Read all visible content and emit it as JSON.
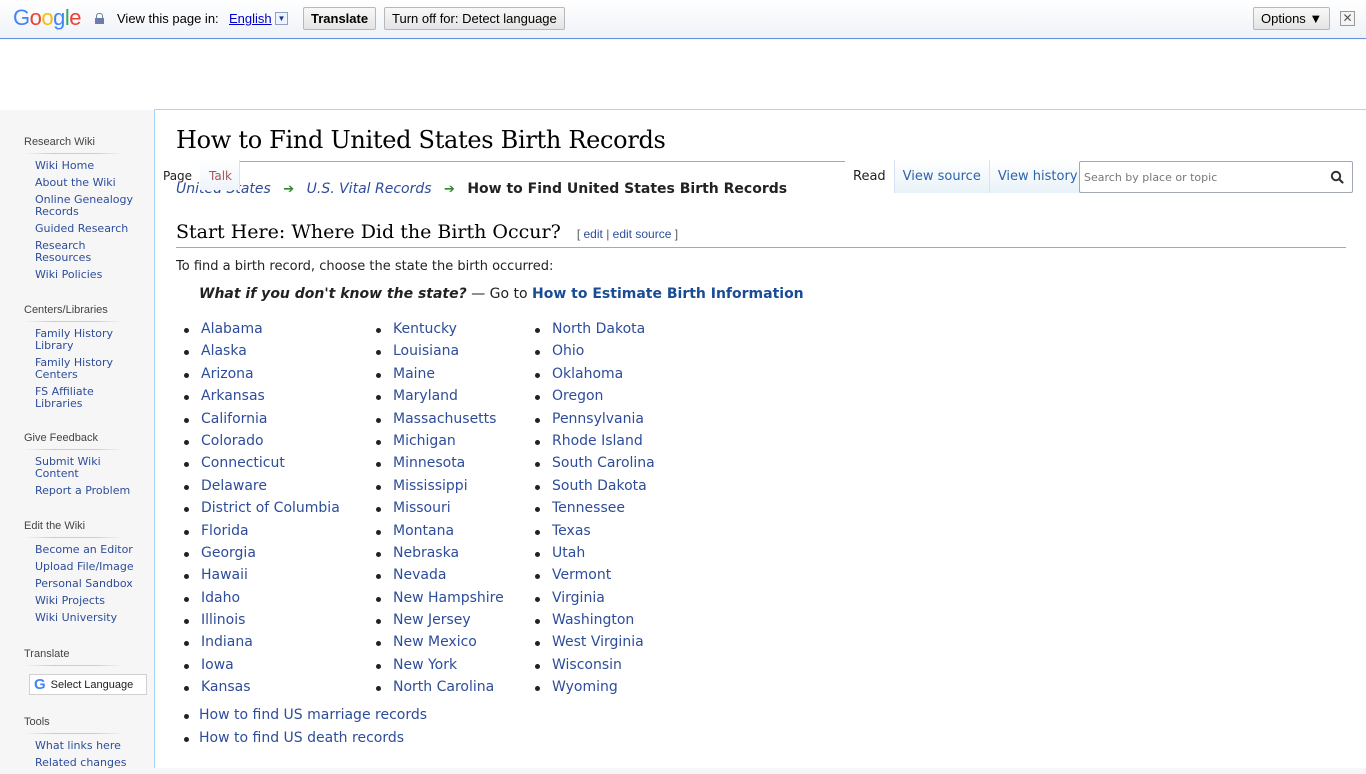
{
  "translate_bar": {
    "logo": [
      "G",
      "o",
      "o",
      "g",
      "l",
      "e"
    ],
    "view_in_label": "View this page in:",
    "language": "English",
    "translate_button": "Translate",
    "turn_off_button": "Turn off for: Detect language",
    "options_button": "Options ▼",
    "close": "✕"
  },
  "sidebar": {
    "sections": [
      {
        "title": "Research Wiki",
        "items": [
          "Wiki Home",
          "About the Wiki",
          "Online Genealogy Records",
          "Guided Research",
          "Research Resources",
          "Wiki Policies"
        ]
      },
      {
        "title": "Centers/Libraries",
        "items": [
          "Family History Library",
          "Family History Centers",
          "FS Affiliate Libraries"
        ]
      },
      {
        "title": "Give Feedback",
        "items": [
          "Submit Wiki Content",
          "Report a Problem"
        ]
      },
      {
        "title": "Edit the Wiki",
        "items": [
          "Become an Editor",
          "Upload File/Image",
          "Personal Sandbox",
          "Wiki Projects",
          "Wiki University"
        ]
      },
      {
        "title": "Translate",
        "select_language": "Select Language"
      },
      {
        "title": "Tools",
        "items": [
          "What links here",
          "Related changes"
        ]
      }
    ]
  },
  "page": {
    "title": "How to Find United States Birth Records",
    "tabs": {
      "page": "Page",
      "talk": "Talk",
      "read": "Read",
      "view_source": "View source",
      "view_history": "View history"
    },
    "search_placeholder": "Search by place or topic",
    "breadcrumb": {
      "first": "United States",
      "second": "U.S. Vital Records",
      "current": "How to Find United States Birth Records"
    },
    "section": {
      "heading": "Start Here: Where Did the Birth Occur?",
      "edit_open": "[",
      "edit": "edit",
      "edit_sep": "|",
      "edit_source": "edit source",
      "edit_close": "]"
    },
    "intro": "To find a birth record, choose the state the birth occurred:",
    "unknown_state": {
      "question": "What if you don't know the state?",
      "dash_text": " — Go to ",
      "link": "How to Estimate Birth Information"
    },
    "states_col1": [
      "Alabama",
      "Alaska",
      "Arizona",
      "Arkansas",
      "California",
      "Colorado",
      "Connecticut",
      "Delaware",
      "District of Columbia",
      "Florida",
      "Georgia",
      "Hawaii",
      "Idaho",
      "Illinois",
      "Indiana",
      "Iowa",
      "Kansas"
    ],
    "states_col2": [
      "Kentucky",
      "Louisiana",
      "Maine",
      "Maryland",
      "Massachusetts",
      "Michigan",
      "Minnesota",
      "Mississippi",
      "Missouri",
      "Montana",
      "Nebraska",
      "Nevada",
      "New Hampshire",
      "New Jersey",
      "New Mexico",
      "New York",
      "North Carolina"
    ],
    "states_col3": [
      "North Dakota",
      "Ohio",
      "Oklahoma",
      "Oregon",
      "Pennsylvania",
      "Rhode Island",
      "South Carolina",
      "South Dakota",
      "Tennessee",
      "Texas",
      "Utah",
      "Vermont",
      "Virginia",
      "Washington",
      "West Virginia",
      "Wisconsin",
      "Wyoming"
    ],
    "more_links": [
      "How to find US marriage records",
      "How to find US death records"
    ]
  }
}
